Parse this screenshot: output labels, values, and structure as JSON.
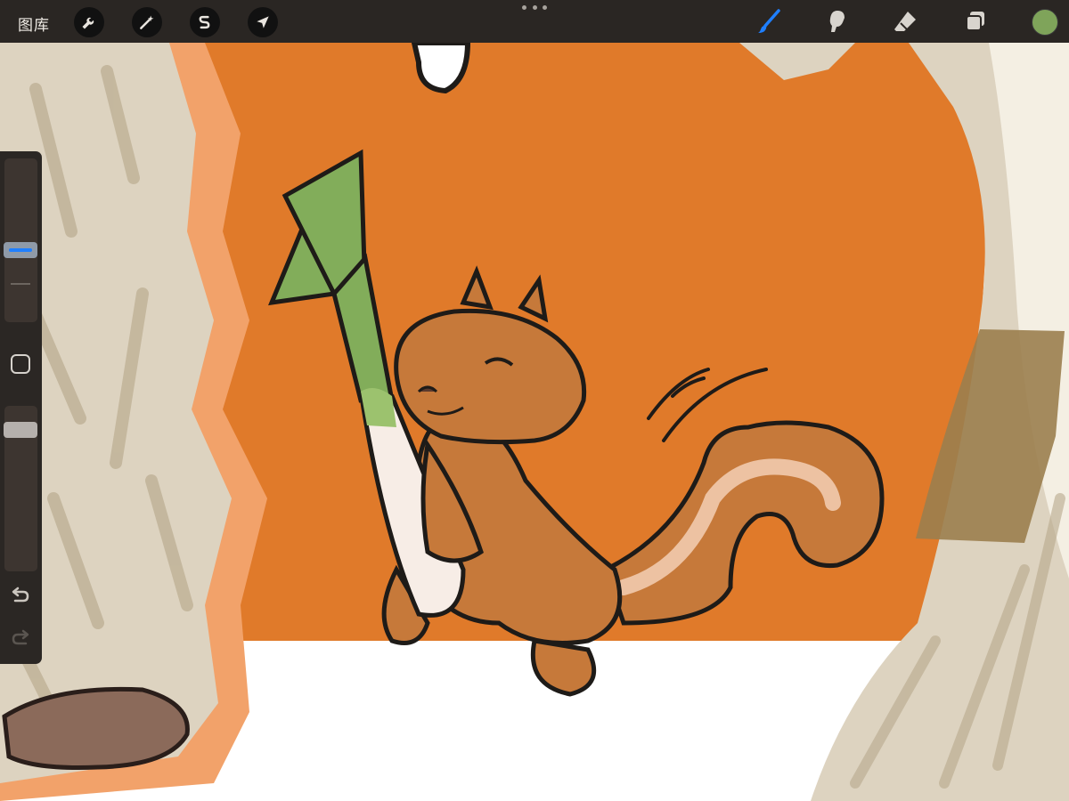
{
  "toolbar": {
    "gallery_label": "图库",
    "left_tools": [
      {
        "icon": "wrench-icon",
        "name": "actions"
      },
      {
        "icon": "magic-wand-icon",
        "name": "adjustments"
      },
      {
        "icon": "selection-s-icon",
        "name": "selection"
      },
      {
        "icon": "arrow-cursor-icon",
        "name": "transform"
      }
    ],
    "right_tools": [
      {
        "icon": "brush-icon",
        "name": "paint",
        "active": true
      },
      {
        "icon": "smudge-icon",
        "name": "smudge",
        "active": false
      },
      {
        "icon": "eraser-icon",
        "name": "eraser",
        "active": false
      },
      {
        "icon": "layers-icon",
        "name": "layers",
        "active": false
      }
    ],
    "current_color": "#7fa45a",
    "active_color": "#1f7fff"
  },
  "sidebar": {
    "brush_size_icon": "size-slider",
    "brush_opacity_icon": "opacity-slider",
    "modify_icon": "square-icon",
    "undo_icon": "undo-icon",
    "redo_icon": "redo-icon"
  },
  "canvas": {
    "background_color": "#e07a2a",
    "floor_color": "#ffffff",
    "subject": "squirrel-holding-leek"
  }
}
